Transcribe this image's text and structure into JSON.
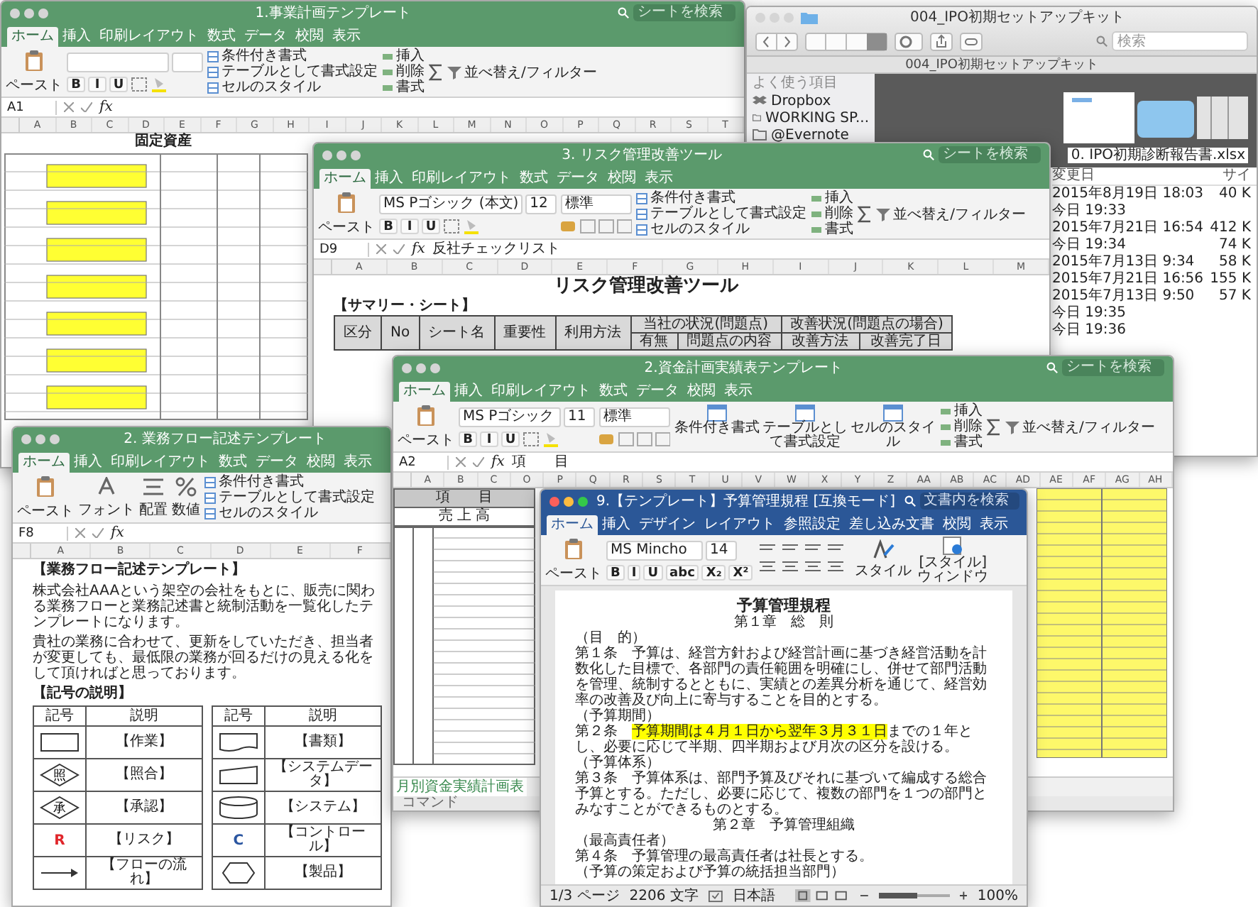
{
  "windows": [
    {
      "kind": "excel",
      "active": false,
      "title": "1.事業計画テンプレート",
      "search": {
        "placeholder": "シートを検索"
      },
      "tabs": [
        {
          "label": "ホーム",
          "selected": true
        },
        {
          "label": "挿入",
          "selected": false
        },
        {
          "label": "印刷レイアウト",
          "selected": false
        },
        {
          "label": "数式",
          "selected": false
        },
        {
          "label": "データ",
          "selected": false
        },
        {
          "label": "校閲",
          "selected": false
        },
        {
          "label": "表示",
          "selected": false
        }
      ],
      "ribbon": [
        {
          "kind": "paste",
          "label": "ペースト"
        },
        {
          "kind": "font",
          "format_buttons": [
            "B",
            "I",
            "U"
          ]
        },
        {
          "kind": "styles",
          "labels": [
            "条件付き書式",
            "テーブルとして書式設定",
            "セルのスタイル"
          ]
        },
        {
          "kind": "cells",
          "labels": [
            "挿入",
            "削除",
            "書式"
          ]
        },
        {
          "kind": "sort",
          "label": "並べ替え/フィルター"
        }
      ],
      "cell_ref": "A1",
      "fx_label": "fx",
      "columns": [
        "A",
        "B",
        "C",
        "D",
        "E",
        "F",
        "G",
        "H",
        "I",
        "J",
        "K",
        "L",
        "M",
        "N",
        "O",
        "P",
        "Q",
        "R",
        "S",
        "T"
      ],
      "sheet": {
        "kind": "plan",
        "title": "固定資産"
      }
    },
    {
      "kind": "finder",
      "active": false,
      "title": "004_IPO初期セットアップキット",
      "search": {
        "placeholder": "検索"
      },
      "path": "004_IPO初期セットアップキット",
      "sidebar": {
        "heading": "よく使う項目",
        "items": [
          {
            "kind": "dropbox",
            "label": "Dropbox"
          },
          {
            "kind": "folder",
            "label": "WORKING SP..."
          },
          {
            "kind": "folder",
            "label": "@Evernote"
          }
        ]
      },
      "preview_caption": "0. IPO初期診断報告書.xlsx",
      "columns": [
        "変更日",
        "サイ"
      ],
      "files": [
        {
          "modified": "2015年8月19日 18:03",
          "size": "40 K"
        },
        {
          "modified": "今日 19:33"
        },
        {
          "modified": "2015年7月21日 16:54",
          "size": "412 K"
        },
        {
          "modified": "今日 19:34",
          "size": "74 K"
        },
        {
          "modified": "2015年7月13日 9:34",
          "size": "58 K"
        },
        {
          "modified": "2015年7月21日 16:56",
          "size": "155 K"
        },
        {
          "modified": "2015年7月13日 9:50",
          "size": "57 K"
        },
        {
          "modified": "今日 19:35"
        },
        {
          "modified": "今日 19:36"
        }
      ]
    },
    {
      "kind": "excel",
      "active": false,
      "title": "2. 業務フロー記述テンプレート",
      "tabs": [
        {
          "label": "ホーム",
          "selected": true
        },
        {
          "label": "挿入",
          "selected": false
        },
        {
          "label": "印刷レイアウト",
          "selected": false
        },
        {
          "label": "数式",
          "selected": false
        },
        {
          "label": "データ",
          "selected": false
        },
        {
          "label": "校閲",
          "selected": false
        },
        {
          "label": "表示",
          "selected": false
        }
      ],
      "ribbon": [
        {
          "kind": "paste",
          "label": "ペースト"
        },
        {
          "kind": "collapsed",
          "label": "フォント"
        },
        {
          "kind": "collapsed",
          "label": "配置"
        },
        {
          "kind": "collapsed",
          "label": "数値"
        },
        {
          "kind": "styles",
          "labels": [
            "条件付き書式",
            "テーブルとして書式設定",
            "セルのスタイル"
          ]
        }
      ],
      "cell_ref": "F8",
      "fx_label": "fx",
      "columns": [
        "A",
        "B",
        "C",
        "D",
        "E",
        "F"
      ],
      "sheet": {
        "kind": "flow",
        "title": "【業務フロー記述テンプレート】",
        "paragraphs": [
          "株式会社AAAという架空の会社をもとに、販売に関わる業務フローと業務記述書と統制活動を一覧化したテンプレートになります。",
          "貴社の業務に合わせて、更新をしていただき、担当者が変更しても、最低限の業務が回るだけの見える化をして頂ければと思っております。"
        ],
        "legend_title": "【記号の説明】",
        "legend_columns": [
          {
            "headers": [
              "記号",
              "説明"
            ],
            "rows": [
              {
                "kind": "rect",
                "label": "【作業】"
              },
              {
                "kind": "diamond",
                "mark": "照",
                "label": "【照合】"
              },
              {
                "kind": "diamond",
                "mark": "承",
                "label": "【承認】"
              },
              {
                "kind": "letter",
                "mark": "R",
                "color": "#e0262b",
                "label": "【リスク】"
              },
              {
                "kind": "arrow",
                "label": "【フローの流れ】"
              }
            ]
          },
          {
            "headers": [
              "記号",
              "説明"
            ],
            "rows": [
              {
                "kind": "document",
                "label": "【書類】"
              },
              {
                "kind": "trapezoid",
                "label": "【システムデータ】"
              },
              {
                "kind": "cylinder",
                "label": "【システム】"
              },
              {
                "kind": "letter",
                "mark": "C",
                "color": "#2a55a0",
                "label": "【コントロール】"
              },
              {
                "kind": "hexagon",
                "label": "【製品】"
              }
            ]
          }
        ]
      }
    },
    {
      "kind": "excel",
      "active": false,
      "title": "3. リスク管理改善ツール",
      "search": {
        "placeholder": "シートを検索"
      },
      "tabs": [
        {
          "label": "ホーム",
          "selected": true
        },
        {
          "label": "挿入",
          "selected": false
        },
        {
          "label": "印刷レイアウト",
          "selected": false
        },
        {
          "label": "数式",
          "selected": false
        },
        {
          "label": "データ",
          "selected": false
        },
        {
          "label": "校閲",
          "selected": false
        },
        {
          "label": "表示",
          "selected": false
        }
      ],
      "ribbon": [
        {
          "kind": "paste",
          "label": "ペースト"
        },
        {
          "kind": "font",
          "name": "MS Pゴシック (本文)",
          "size": "12",
          "format_buttons": [
            "B",
            "I",
            "U"
          ]
        },
        {
          "kind": "number",
          "format": "標準"
        },
        {
          "kind": "styles",
          "labels": [
            "条件付き書式",
            "テーブルとして書式設定",
            "セルのスタイル"
          ]
        },
        {
          "kind": "cells",
          "labels": [
            "挿入",
            "削除",
            "書式"
          ]
        },
        {
          "kind": "sort",
          "label": "並べ替え/フィルター"
        }
      ],
      "cell_ref": "D9",
      "fx_label": "fx",
      "formula": "反社チェックリスト",
      "columns": [
        "A",
        "B",
        "C",
        "D",
        "E",
        "F",
        "G",
        "H",
        "I",
        "J",
        "K",
        "L",
        "M"
      ],
      "sheet": {
        "kind": "risk",
        "title": "リスク管理改善ツール",
        "subtitle": "【サマリー・シート】",
        "headers": [
          "区分",
          "No",
          "シート名",
          "重要性",
          "利用方法"
        ],
        "groups": [
          {
            "label": "当社の状況(問題点)",
            "columns": [
              "有無",
              "問題点の内容"
            ]
          },
          {
            "label": "改善状況(問題点の場合)",
            "columns": [
              "改善方法",
              "改善完了日"
            ]
          }
        ]
      }
    },
    {
      "kind": "excel",
      "active": false,
      "title": "2.資金計画実績表テンプレート",
      "search": {
        "placeholder": "シートを検索"
      },
      "tabs": [
        {
          "label": "ホーム",
          "selected": true
        },
        {
          "label": "挿入",
          "selected": false
        },
        {
          "label": "印刷レイアウト",
          "selected": false
        },
        {
          "label": "数式",
          "selected": false
        },
        {
          "label": "データ",
          "selected": false
        },
        {
          "label": "校閲",
          "selected": false
        },
        {
          "label": "表示",
          "selected": false
        }
      ],
      "ribbon": [
        {
          "kind": "paste",
          "label": "ペースト"
        },
        {
          "kind": "font",
          "name": "MS Pゴシック",
          "size": "11",
          "format_buttons": [
            "B",
            "I",
            "U"
          ]
        },
        {
          "kind": "number",
          "format": "標準"
        },
        {
          "kind": "styles_big",
          "labels": [
            "条件付き書式",
            "テーブルとして書式設定",
            "セルのスタイル"
          ]
        },
        {
          "kind": "cells",
          "labels": [
            "挿入",
            "削除",
            "書式"
          ]
        },
        {
          "kind": "sort",
          "label": "並べ替え/フィルター"
        }
      ],
      "cell_ref": "A2",
      "fx_label": "fx",
      "formula": "項　　目",
      "columns": [
        "A",
        "B",
        "C",
        "O",
        "P",
        "Q",
        "R",
        "S",
        "T",
        "U",
        "V",
        "W",
        "X",
        "Y",
        "Z",
        "AA",
        "AB",
        "AC",
        "AD",
        "AE",
        "AF",
        "AG",
        "AH"
      ],
      "sheet": {
        "kind": "fund",
        "header": "項　　目",
        "first_row": "売 上 高"
      },
      "sheet_tabs": [
        {
          "label": "月別資金実績計画表",
          "selected": true
        }
      ],
      "status": "コマンド"
    },
    {
      "kind": "word",
      "active": true,
      "title": "9.【テンプレート】予算管理規程 [互換モード]",
      "search": {
        "placeholder": "文書内を検索"
      },
      "tabs": [
        {
          "label": "ホーム",
          "selected": true
        },
        {
          "label": "挿入",
          "selected": false
        },
        {
          "label": "デザイン",
          "selected": false
        },
        {
          "label": "レイアウト",
          "selected": false
        },
        {
          "label": "参照設定",
          "selected": false
        },
        {
          "label": "差し込み文書",
          "selected": false
        },
        {
          "label": "校閲",
          "selected": false
        },
        {
          "label": "表示",
          "selected": false
        }
      ],
      "ribbon": {
        "paste": "ペースト",
        "font": "MS Mincho",
        "size": "14",
        "format_buttons": [
          "B",
          "I",
          "U",
          "abc",
          "X₂",
          "X²"
        ],
        "style": "スタイル",
        "style_pane": "[スタイル] ウィンドウ"
      },
      "document": {
        "title": "予算管理規程",
        "blocks": [
          {
            "kind": "chapter",
            "text": "第１章　総　則"
          },
          {
            "kind": "heading",
            "text": "（目　的）"
          },
          {
            "kind": "article",
            "parts": [
              {
                "text": "第１条　予算は、経営方針および経営計画に基づき経営活動を計数化した目標で、各部門の責任範囲を明確にし、併せて部門活動を管理、統制するとともに、実績との差異分析を通じて、経営効率の改善及び向上に寄与することを目的とする。",
                "highlight": false
              }
            ]
          },
          {
            "kind": "heading",
            "text": "（予算期間）"
          },
          {
            "kind": "article",
            "parts": [
              {
                "text": "第２条　",
                "highlight": false
              },
              {
                "text": "予算期間は４月１日から翌年３月３１日",
                "highlight": true
              },
              {
                "text": "までの１年とし、必要に応じて半期、四半期および月次の区分を設ける。",
                "highlight": false
              }
            ]
          },
          {
            "kind": "heading",
            "text": "（予算体系）"
          },
          {
            "kind": "article",
            "parts": [
              {
                "text": "第３条　予算体系は、部門予算及びそれに基づいて編成する総合予算とする。ただし、必要に応じて、複数の部門を１つの部門とみなすことができるものとする。",
                "highlight": false
              }
            ]
          },
          {
            "kind": "chapter",
            "text": "第２章　予算管理組織"
          },
          {
            "kind": "heading",
            "text": "（最高責任者）"
          },
          {
            "kind": "article",
            "parts": [
              {
                "text": "第４条　予算管理の最高責任者は社長とする。",
                "highlight": false
              }
            ]
          },
          {
            "kind": "heading",
            "text": "（予算の策定および予算の統括担当部門）"
          }
        ]
      },
      "status": {
        "page": "1/3 ページ",
        "words": "2206 文字",
        "language": "日本語",
        "zoom": {
          "level": 0.55
        },
        "zoom_label": "100%"
      }
    }
  ]
}
